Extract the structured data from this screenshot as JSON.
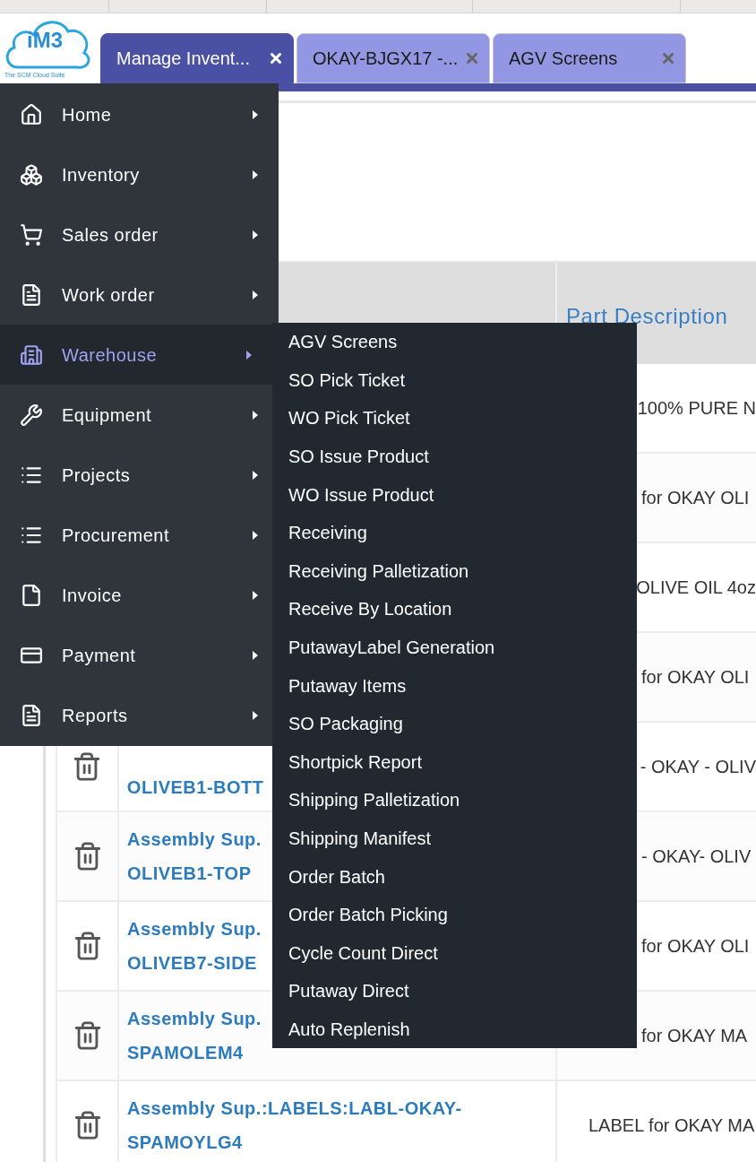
{
  "logo": {
    "mark": "iM3",
    "tagline": "The SCM Cloud Suite"
  },
  "tabs": [
    {
      "label": "Manage Invent...",
      "selected": true
    },
    {
      "label": "OKAY-BJGX17 -...",
      "selected": false
    },
    {
      "label": "AGV Screens",
      "selected": false
    }
  ],
  "menu": {
    "items": [
      {
        "label": "Home",
        "selected": false
      },
      {
        "label": "Inventory",
        "selected": false
      },
      {
        "label": "Sales order",
        "selected": false
      },
      {
        "label": "Work order",
        "selected": false
      },
      {
        "label": "Warehouse",
        "selected": true
      },
      {
        "label": "Equipment",
        "selected": false
      },
      {
        "label": "Projects",
        "selected": false
      },
      {
        "label": "Procurement",
        "selected": false
      },
      {
        "label": "Invoice",
        "selected": false
      },
      {
        "label": "Payment",
        "selected": false
      },
      {
        "label": "Reports",
        "selected": false
      }
    ]
  },
  "submenu": {
    "items": [
      "AGV Screens",
      "SO Pick Ticket",
      "WO Pick Ticket",
      "SO Issue Product",
      "WO Issue Product",
      "Receiving",
      "Receiving Palletization",
      "Receive By Location",
      "PutawayLabel Generation",
      "Putaway Items",
      "SO Packaging",
      "Shortpick Report",
      "Shipping Palletization",
      "Shipping Manifest",
      "Order Batch",
      "Order Batch Picking",
      "Cycle Count Direct",
      "Putaway Direct",
      "Auto Replenish"
    ]
  },
  "table": {
    "columns": [
      "Part Description"
    ],
    "rows": [
      {
        "description": "100% PURE N"
      },
      {
        "description": "for OKAY OLI"
      },
      {
        "description": "OLIVE OIL 4oz"
      },
      {
        "description": "for OKAY OLI"
      },
      {
        "part": [
          "OLIVEB1-BOTT"
        ],
        "description": "- OKAY - OLIV"
      },
      {
        "part": [
          "Assembly Sup.",
          "OLIVEB1-TOP"
        ],
        "description": "- OKAY- OLIV"
      },
      {
        "part": [
          "Assembly Sup.",
          "OLIVEB7-SIDE"
        ],
        "description": "for OKAY OLI"
      },
      {
        "part": [
          "Assembly Sup.",
          "SPAMOLEM4"
        ],
        "description": "for OKAY MA"
      },
      {
        "part": [
          "Assembly Sup.:LABELS:LABL-OKAY-",
          "SPAMOYLG4"
        ],
        "description": "LABEL for OKAY MA"
      }
    ]
  }
}
